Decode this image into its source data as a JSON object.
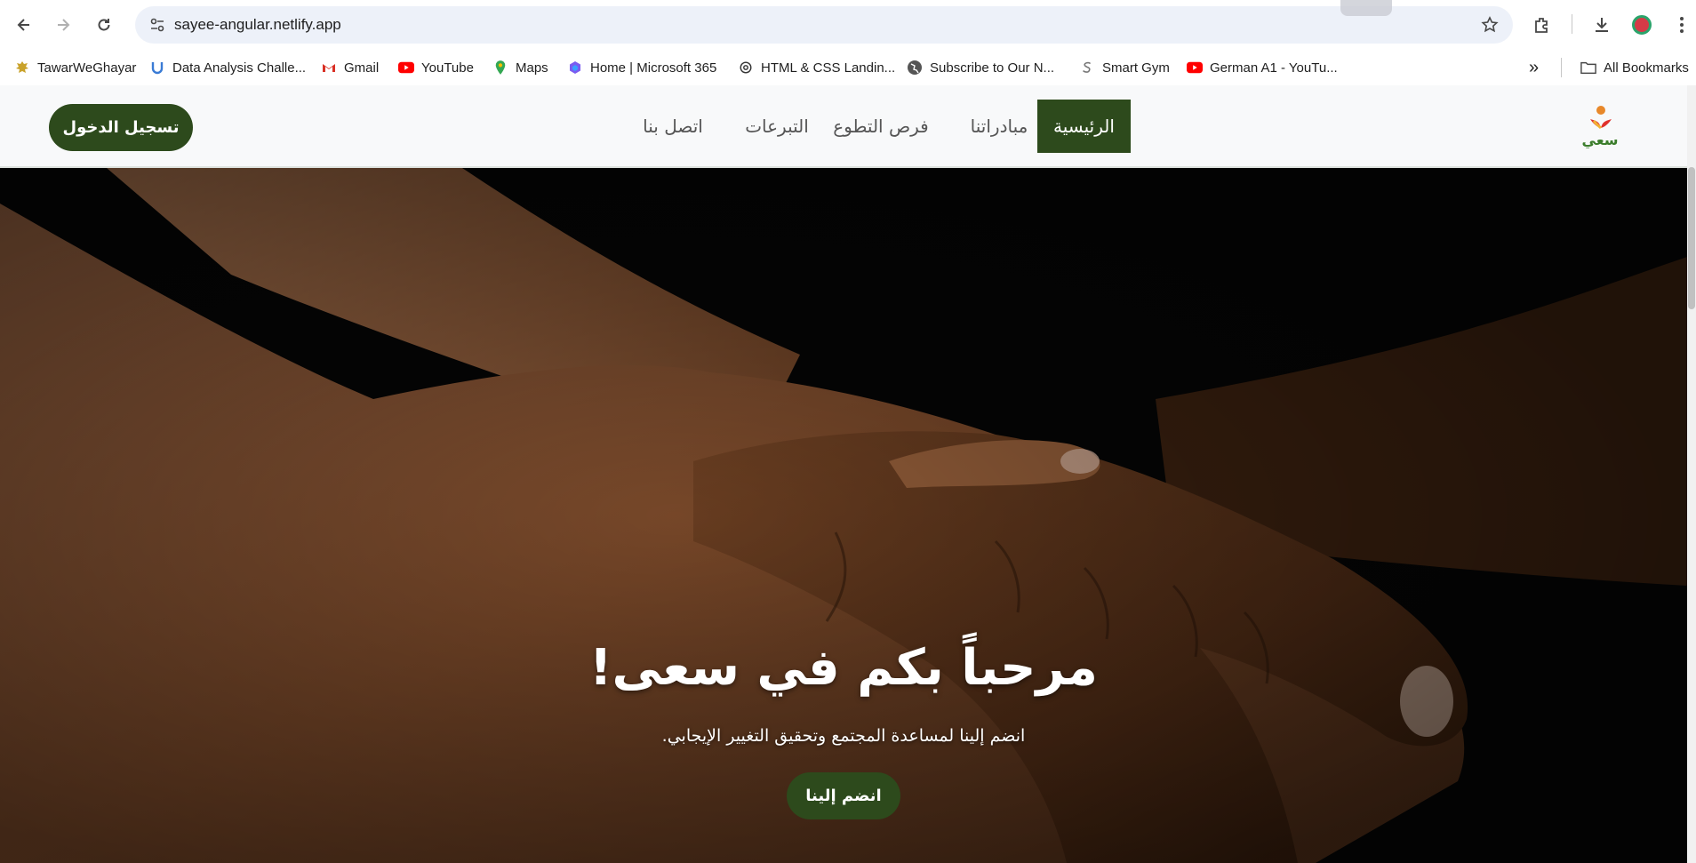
{
  "browser": {
    "url": "sayee-angular.netlify.app",
    "bookmarks": [
      {
        "label": "TawarWeGhayar",
        "icon": "egypt-eagle-icon"
      },
      {
        "label": "Data Analysis Challe...",
        "icon": "udemy-icon"
      },
      {
        "label": "Gmail",
        "icon": "gmail-icon"
      },
      {
        "label": "YouTube",
        "icon": "youtube-icon"
      },
      {
        "label": "Maps",
        "icon": "maps-pin-icon"
      },
      {
        "label": "Home | Microsoft 365",
        "icon": "microsoft365-icon"
      },
      {
        "label": "HTML & CSS Landin...",
        "icon": "openai-icon"
      },
      {
        "label": "Subscribe to Our N...",
        "icon": "globe-icon"
      },
      {
        "label": "Smart Gym",
        "icon": "s-logo-icon"
      },
      {
        "label": "German A1 - YouTu...",
        "icon": "youtube-icon"
      }
    ],
    "more_bookmarks": "»",
    "all_bookmarks": "All Bookmarks"
  },
  "site": {
    "logo_text": "سعي",
    "login_button": "تسجيل الدخول",
    "nav": [
      {
        "label": "الرئيسية",
        "active": true
      },
      {
        "label": "مبادراتنا",
        "active": false
      },
      {
        "label": "فرص التطوع",
        "active": false
      },
      {
        "label": "التبرعات",
        "active": false
      },
      {
        "label": "اتصل بنا",
        "active": false
      }
    ],
    "hero": {
      "title": "مرحباً بكم في سعى!",
      "subtitle": "انضم إلينا لمساعدة المجتمع وتحقيق التغيير الإيجابي.",
      "button": "انضم إلينا"
    }
  },
  "colors": {
    "brand_green": "#2d4a1c",
    "header_bg": "#f8f9fa",
    "hero_bg": "#050505"
  }
}
